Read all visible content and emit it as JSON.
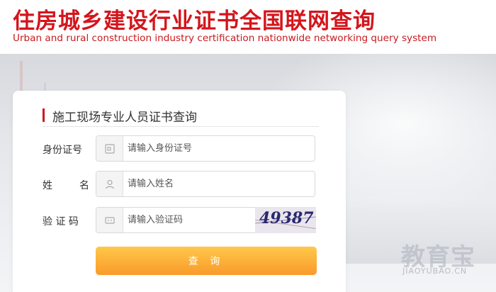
{
  "header": {
    "title": "住房城乡建设行业证书全国联网查询",
    "subtitle": "Urban and rural construction industry certification nationwide networking query system"
  },
  "panel": {
    "title": "施工现场专业人员证书查询"
  },
  "form": {
    "id_label": "身份证号",
    "id_placeholder": "请输入身份证号",
    "name_label": "姓　名",
    "name_placeholder": "请输入姓名",
    "captcha_label": "验 证 码",
    "captcha_placeholder": "请输入验证码",
    "captcha_text": "49387",
    "submit_label": "查 询"
  },
  "watermark": {
    "text": "教育宝",
    "sub": "JIAOYUBAO.CN"
  },
  "colors": {
    "brand_red": "#d4151c",
    "button_orange": "#f99a2a"
  },
  "icons": {
    "id": "id-card-icon",
    "name": "user-icon",
    "captcha": "captcha-icon"
  }
}
